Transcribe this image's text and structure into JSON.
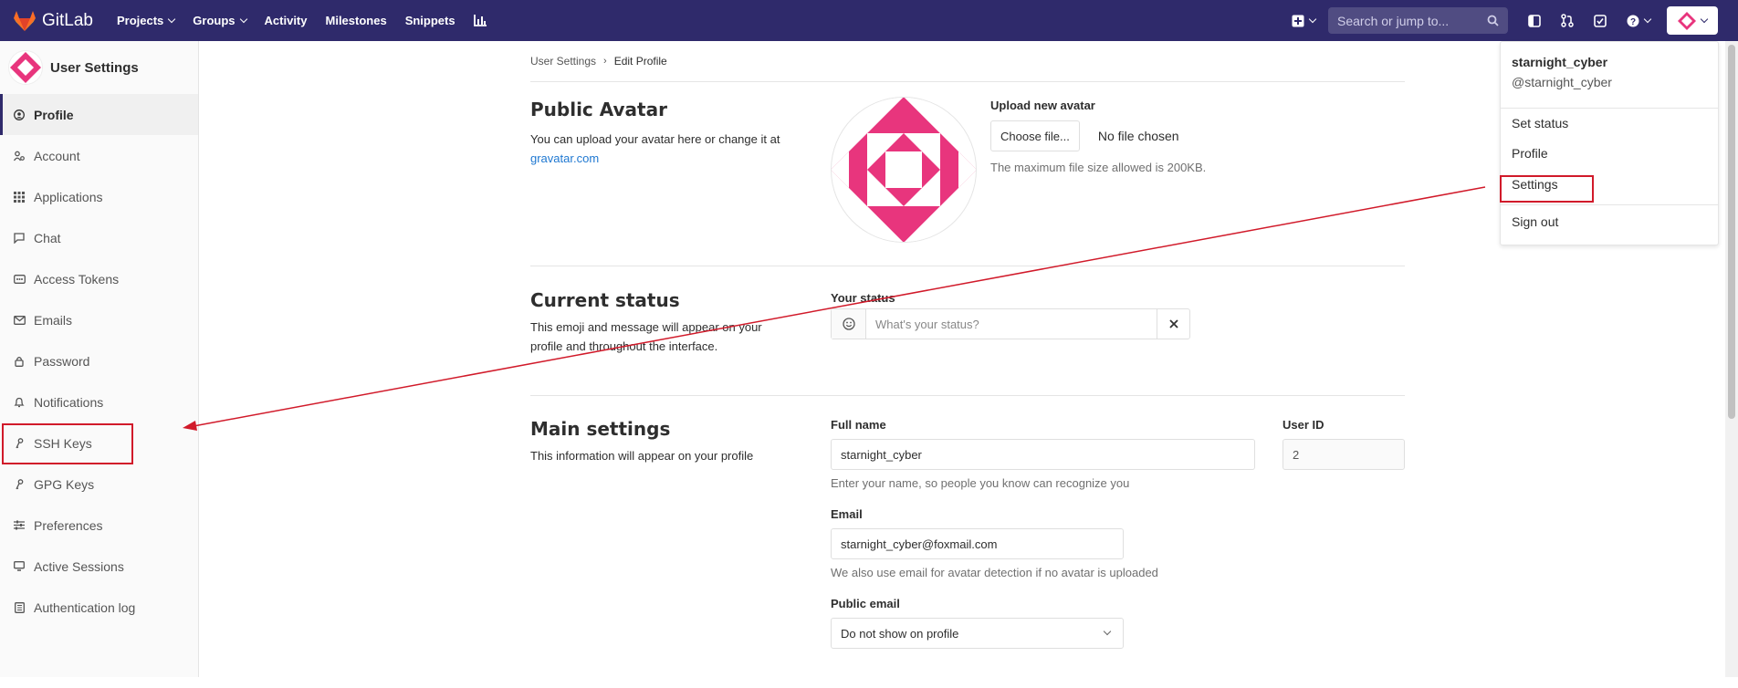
{
  "navbar": {
    "brand": "GitLab",
    "links": [
      "Projects",
      "Groups",
      "Activity",
      "Milestones",
      "Snippets"
    ],
    "search_placeholder": "Search or jump to..."
  },
  "sidebar": {
    "title": "User Settings",
    "items": [
      {
        "label": "Profile",
        "icon": "profile-icon"
      },
      {
        "label": "Account",
        "icon": "account-icon"
      },
      {
        "label": "Applications",
        "icon": "applications-icon"
      },
      {
        "label": "Chat",
        "icon": "chat-icon"
      },
      {
        "label": "Access Tokens",
        "icon": "token-icon"
      },
      {
        "label": "Emails",
        "icon": "email-icon"
      },
      {
        "label": "Password",
        "icon": "lock-icon"
      },
      {
        "label": "Notifications",
        "icon": "bell-icon"
      },
      {
        "label": "SSH Keys",
        "icon": "key-icon"
      },
      {
        "label": "GPG Keys",
        "icon": "key-icon"
      },
      {
        "label": "Preferences",
        "icon": "preferences-icon"
      },
      {
        "label": "Active Sessions",
        "icon": "monitor-icon"
      },
      {
        "label": "Authentication log",
        "icon": "log-icon"
      }
    ]
  },
  "breadcrumb": {
    "parent": "User Settings",
    "sep": "›",
    "current": "Edit Profile"
  },
  "avatar_section": {
    "title": "Public Avatar",
    "desc": "You can upload your avatar here or change it at",
    "link": "gravatar.com",
    "upload_label": "Upload new avatar",
    "choose_button": "Choose file...",
    "no_file": "No file chosen",
    "help": "The maximum file size allowed is 200KB."
  },
  "status_section": {
    "title": "Current status",
    "desc": "This emoji and message will appear on your profile and throughout the interface.",
    "label": "Your status",
    "placeholder": "What's your status?"
  },
  "main_section": {
    "title": "Main settings",
    "desc": "This information will appear on your profile",
    "full_name_label": "Full name",
    "full_name_value": "starnight_cyber",
    "full_name_help": "Enter your name, so people you know can recognize you",
    "user_id_label": "User ID",
    "user_id_value": "2",
    "email_label": "Email",
    "email_value": "starnight_cyber@foxmail.com",
    "email_help": "We also use email for avatar detection if no avatar is uploaded",
    "public_email_label": "Public email",
    "public_email_value": "Do not show on profile"
  },
  "user_menu": {
    "name": "starnight_cyber",
    "handle": "@starnight_cyber",
    "items": [
      "Set status",
      "Profile",
      "Settings",
      "Sign out"
    ]
  },
  "colors": {
    "navbar": "#2f2a6b",
    "avatar_pink": "#e8357d",
    "annotation": "#d11a2a"
  }
}
